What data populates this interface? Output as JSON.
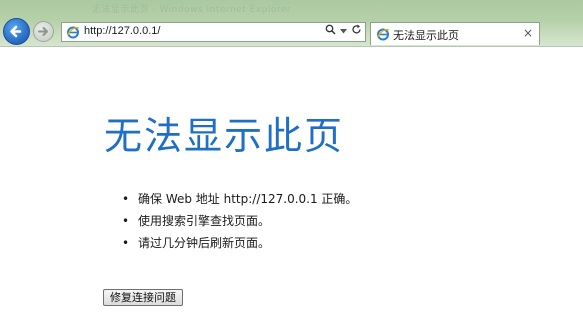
{
  "browser": {
    "window_title": "无法显示此页 - Windows Internet Explorer",
    "address": {
      "url": "http://127.0.0.1/",
      "search_icon": "search-icon",
      "dropdown_icon": "chevron-down-icon",
      "refresh_icon": "refresh-icon"
    },
    "tab": {
      "title": "无法显示此页",
      "close_label": "×"
    },
    "nav": {
      "back_icon": "back-arrow-icon",
      "forward_icon": "forward-arrow-icon"
    }
  },
  "page": {
    "heading": "无法显示此页",
    "bullets": [
      {
        "symbol": "•",
        "text": "确保 Web 地址 http://127.0.0.1 正确。"
      },
      {
        "symbol": "•",
        "text": "使用搜索引擎查找页面。"
      },
      {
        "symbol": "•",
        "text": "请过几分钟后刷新页面。"
      }
    ],
    "repair_button": "修复连接问题"
  },
  "colors": {
    "heading": "#1f6fc6",
    "chrome_green": "#b6d1a9",
    "back_button_blue": "#2a6fc9"
  }
}
